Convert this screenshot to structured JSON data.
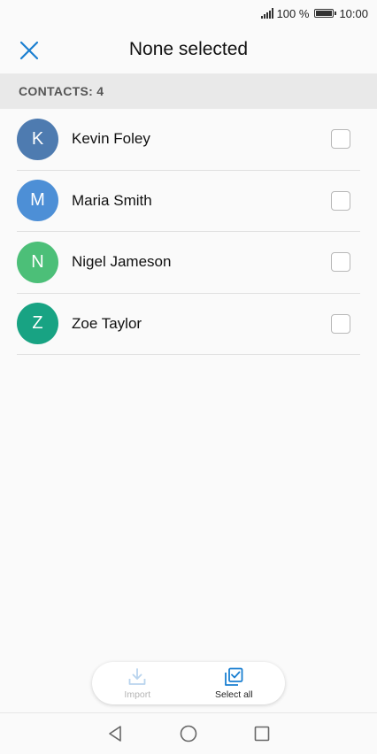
{
  "status_bar": {
    "battery_text": "100 %",
    "time": "10:00"
  },
  "header": {
    "title": "None selected",
    "close_icon": "close-icon"
  },
  "section": {
    "label": "CONTACTS: 4"
  },
  "contacts": [
    {
      "initial": "K",
      "name": "Kevin Foley",
      "color": "#4e7bb0",
      "checked": false
    },
    {
      "initial": "M",
      "name": "Maria Smith",
      "color": "#4d8fd6",
      "checked": false
    },
    {
      "initial": "N",
      "name": "Nigel Jameson",
      "color": "#4cbf78",
      "checked": false
    },
    {
      "initial": "Z",
      "name": "Zoe Taylor",
      "color": "#18a383",
      "checked": false
    }
  ],
  "actions": {
    "import_label": "Import",
    "select_all_label": "Select all"
  },
  "colors": {
    "accent": "#1a7fd1",
    "section_bg": "#e9e9e9"
  }
}
